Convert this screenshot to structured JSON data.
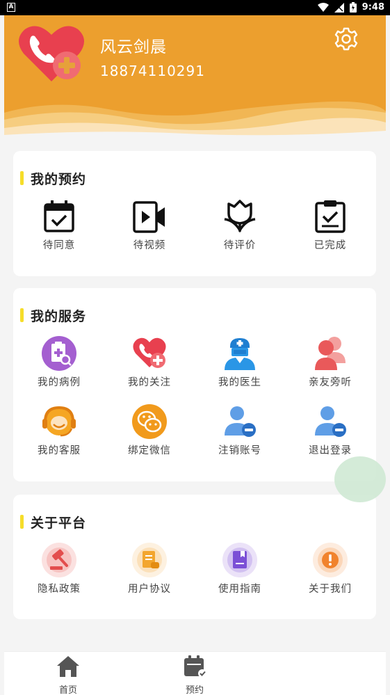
{
  "status_bar": {
    "time": "9:48",
    "app_indicator": "A"
  },
  "profile": {
    "name": "风云剑晨",
    "phone": "18874110291"
  },
  "appointments": {
    "title": "我的预约",
    "items": [
      {
        "label": "待同意",
        "icon": "calendar-check-icon"
      },
      {
        "label": "待视频",
        "icon": "video-icon"
      },
      {
        "label": "待评价",
        "icon": "flower-icon"
      },
      {
        "label": "已完成",
        "icon": "clipboard-check-icon"
      }
    ]
  },
  "services": {
    "title": "我的服务",
    "items": [
      {
        "label": "我的病例",
        "icon": "medical-record-icon"
      },
      {
        "label": "我的关注",
        "icon": "heart-plus-icon"
      },
      {
        "label": "我的医生",
        "icon": "doctor-icon"
      },
      {
        "label": "亲友旁听",
        "icon": "family-icon"
      },
      {
        "label": "我的客服",
        "icon": "customer-service-icon"
      },
      {
        "label": "绑定微信",
        "icon": "wechat-icon"
      },
      {
        "label": "注销账号",
        "icon": "user-remove-icon"
      },
      {
        "label": "退出登录",
        "icon": "logout-user-icon"
      }
    ]
  },
  "platform": {
    "title": "关于平台",
    "items": [
      {
        "label": "隐私政策",
        "icon": "gavel-icon"
      },
      {
        "label": "用户协议",
        "icon": "agreement-icon"
      },
      {
        "label": "使用指南",
        "icon": "guide-book-icon"
      },
      {
        "label": "关于我们",
        "icon": "info-icon"
      }
    ]
  },
  "bottom_nav": {
    "items": [
      {
        "label": "首页",
        "icon": "home-icon"
      },
      {
        "label": "预约",
        "icon": "appointment-icon"
      }
    ]
  },
  "colors": {
    "header": "#ec9f2e",
    "accent_bar": "#f6dd2a",
    "page_bg": "#f4f4f4"
  }
}
